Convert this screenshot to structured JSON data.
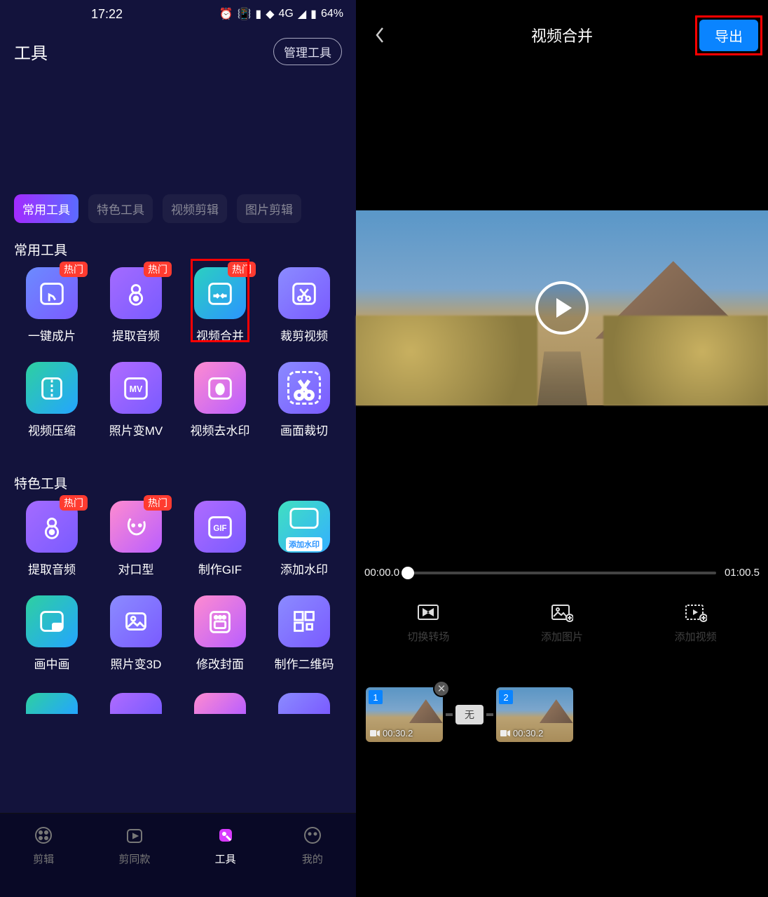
{
  "status": {
    "time": "17:22",
    "net": "4G",
    "battery": "64%"
  },
  "left": {
    "title": "工具",
    "manage": "管理工具",
    "tabs": [
      "常用工具",
      "特色工具",
      "视频剪辑",
      "图片剪辑"
    ],
    "sections": {
      "common": {
        "title": "常用工具",
        "items": [
          {
            "label": "一键成片",
            "badge": "热门",
            "icon": "tap",
            "grad": "grad-blue"
          },
          {
            "label": "提取音频",
            "badge": "热门",
            "icon": "speaker",
            "grad": "grad-purple"
          },
          {
            "label": "视频合并",
            "badge": "热门",
            "icon": "merge",
            "grad": "grad-teal",
            "highlight": true
          },
          {
            "label": "裁剪视频",
            "badge": "",
            "icon": "scissors",
            "grad": "grad-tr"
          },
          {
            "label": "视频压缩",
            "badge": "",
            "icon": "compress",
            "grad": "grad-teal2"
          },
          {
            "label": "照片变MV",
            "badge": "",
            "icon": "mv",
            "grad": "grad-vio"
          },
          {
            "label": "视频去水印",
            "badge": "",
            "icon": "dewm",
            "grad": "grad-pink"
          },
          {
            "label": "画面裁切",
            "badge": "",
            "icon": "crop",
            "grad": "grad-tr"
          }
        ]
      },
      "special": {
        "title": "特色工具",
        "items": [
          {
            "label": "提取音频",
            "badge": "热门",
            "icon": "speaker",
            "grad": "grad-purple"
          },
          {
            "label": "对口型",
            "badge": "热门",
            "icon": "face",
            "grad": "grad-pink"
          },
          {
            "label": "制作GIF",
            "badge": "",
            "icon": "gif",
            "grad": "grad-vio"
          },
          {
            "label": "添加水印",
            "badge": "",
            "icon": "addwm",
            "grad": "grad-cyan",
            "wm": "添加水印"
          },
          {
            "label": "画中画",
            "badge": "",
            "icon": "pip",
            "grad": "grad-teal2"
          },
          {
            "label": "照片变3D",
            "badge": "",
            "icon": "photo",
            "grad": "grad-tr"
          },
          {
            "label": "修改封面",
            "badge": "",
            "icon": "cover",
            "grad": "grad-pink"
          },
          {
            "label": "制作二维码",
            "badge": "",
            "icon": "qr",
            "grad": "grad-tr"
          }
        ]
      }
    },
    "nav": [
      {
        "label": "剪辑",
        "icon": "edit"
      },
      {
        "label": "剪同款",
        "icon": "sametpl"
      },
      {
        "label": "工具",
        "icon": "tools",
        "active": true
      },
      {
        "label": "我的",
        "icon": "me"
      }
    ]
  },
  "right": {
    "title": "视频合并",
    "export": "导出",
    "time_start": "00:00.0",
    "time_end": "01:00.5",
    "actions": [
      {
        "label": "切换转场",
        "icon": "transition"
      },
      {
        "label": "添加图片",
        "icon": "addimage"
      },
      {
        "label": "添加视频",
        "icon": "addvideo"
      }
    ],
    "transition": "无",
    "clips": [
      {
        "seq": "1",
        "dur": "00:30.2"
      },
      {
        "seq": "2",
        "dur": "00:30.2"
      }
    ]
  }
}
